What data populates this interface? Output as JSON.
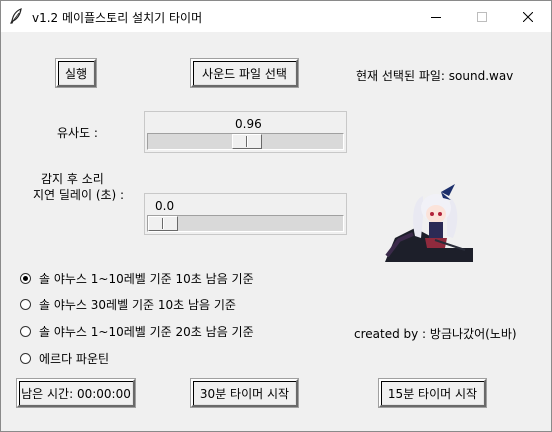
{
  "window": {
    "title": "v1.2 메이플스토리 설치기 타이머"
  },
  "buttons": {
    "run": "실행",
    "select_sound": "사운드 파일 선택",
    "remaining_time": "남은 시간: 00:00:00",
    "start_30": "30분 타이머 시작",
    "start_15": "15분 타이머 시작"
  },
  "current_file_label": "현재 선택된 파일: sound.wav",
  "similarity": {
    "label": "유사도 :",
    "value": "0.96",
    "level": 0.96
  },
  "delay": {
    "label_line1": "감지 후 소리",
    "label_line2": "지연 딜레이 (초) :",
    "value": "0.0",
    "level": 0.0
  },
  "modes": [
    {
      "label": "솔 야누스 1~10레벨 기준 10초 남음 기준",
      "checked": true
    },
    {
      "label": "솔 야누스 30레벨 기준 10초 남음 기준",
      "checked": false
    },
    {
      "label": "솔 야누스 1~10레벨 기준 20초 남음 기준",
      "checked": false
    },
    {
      "label": "에르다 파운틴",
      "checked": false
    }
  ],
  "credit": "created by : 방금나갔어(노바)",
  "icons": {
    "app": "feather-icon",
    "minimize": "minimize-icon",
    "maximize": "maximize-icon",
    "close": "close-icon",
    "character": "character-image"
  }
}
